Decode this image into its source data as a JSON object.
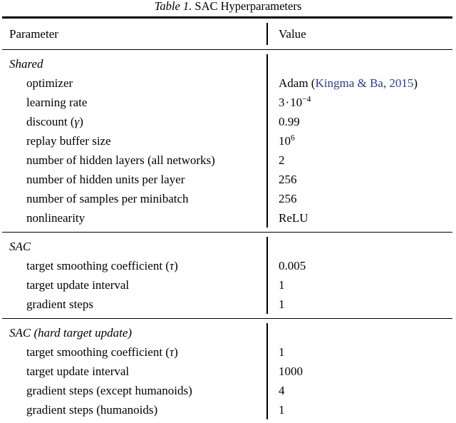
{
  "caption": {
    "label": "Table 1.",
    "text": "SAC Hyperparameters"
  },
  "table": {
    "columns": {
      "parameter": "Parameter",
      "value": "Value"
    },
    "citation_color": "#2e3b8f",
    "sections": [
      {
        "title": "Shared",
        "rows": [
          {
            "parameter": "optimizer",
            "value_prefix": "Adam (",
            "value_cite": "Kingma & Ba, 2015",
            "value_suffix": ")"
          },
          {
            "parameter": "learning rate",
            "value_mantissa": "3",
            "value_dot": "·",
            "value_base": "10",
            "value_exp": "−4"
          },
          {
            "parameter_prefix": "discount (",
            "parameter_symbol": "γ",
            "parameter_suffix": ")",
            "value": "0.99"
          },
          {
            "parameter": "replay buffer size",
            "value_base": "10",
            "value_exp": "6"
          },
          {
            "parameter": "number of hidden layers (all networks)",
            "value": "2"
          },
          {
            "parameter": "number of hidden units per layer",
            "value": "256"
          },
          {
            "parameter": "number of samples per minibatch",
            "value": "256"
          },
          {
            "parameter": "nonlinearity",
            "value": "ReLU"
          }
        ]
      },
      {
        "title": "SAC",
        "rows": [
          {
            "parameter_prefix": "target smoothing coefficient (",
            "parameter_symbol": "τ",
            "parameter_suffix": ")",
            "value": "0.005"
          },
          {
            "parameter": "target update interval",
            "value": "1"
          },
          {
            "parameter": "gradient steps",
            "value": "1"
          }
        ]
      },
      {
        "title": "SAC (hard target update)",
        "rows": [
          {
            "parameter_prefix": "target smoothing coefficient (",
            "parameter_symbol": "τ",
            "parameter_suffix": ")",
            "value": "1"
          },
          {
            "parameter": "target update interval",
            "value": "1000"
          },
          {
            "parameter": "gradient steps (except humanoids)",
            "value": "4"
          },
          {
            "parameter": "gradient steps (humanoids)",
            "value": "1"
          }
        ]
      }
    ]
  }
}
